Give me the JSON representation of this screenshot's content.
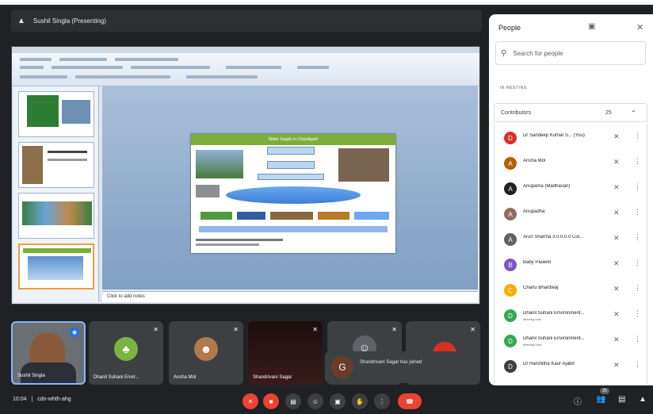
{
  "topbar": {
    "presenter_label": "Sushil Singla (Presenting)"
  },
  "presentation": {
    "notes_placeholder": "Click to add notes",
    "slide_title": "Water Supply in Chandigarh"
  },
  "tiles": [
    {
      "name": "Sushil Singla"
    },
    {
      "name": "Dhanil Suhani Envir..."
    },
    {
      "name": "Ansha Mol"
    },
    {
      "name": "Shandrivani Sagar"
    },
    {
      "name": ""
    },
    {
      "name": ""
    }
  ],
  "toast": {
    "avatar_letter": "G",
    "message": "Shandrivani Sagar has joined"
  },
  "bottom": {
    "time": "10:04",
    "separator": "|",
    "meeting_code": "cdn-whth-ahg"
  },
  "badge_count": "25",
  "people": {
    "title": "People",
    "search_placeholder": "Search for people",
    "section_label": "IN MEETING",
    "contributors_label": "Contributors",
    "contributors_count": "25",
    "items": [
      {
        "name": "Dr Sandeep Kumar S... (You)",
        "sub": "",
        "color": "#d93025",
        "letter": "D"
      },
      {
        "name": "Ansha Mol",
        "sub": "",
        "color": "#b06000",
        "letter": "A"
      },
      {
        "name": "Anupama (Madhavan)",
        "sub": "",
        "color": "#202124",
        "letter": "A"
      },
      {
        "name": "Anupadha",
        "sub": "",
        "color": "#8d6e63",
        "letter": "A"
      },
      {
        "name": "Arun Sharma 3.0.0.0.0 Col...",
        "sub": "",
        "color": "#5f6368",
        "letter": "A"
      },
      {
        "name": "Baby Pauwel",
        "sub": "",
        "color": "#7e57c2",
        "letter": "B"
      },
      {
        "name": "Charlu Bhardwaj",
        "sub": "",
        "color": "#f9ab00",
        "letter": "C"
      },
      {
        "name": "Dhanil Suhani Environment...",
        "sub": "Meeting host",
        "color": "#34a853",
        "letter": "D"
      },
      {
        "name": "Dhanil Suhani Environment...",
        "sub": "Meeting host",
        "color": "#34a853",
        "letter": "D"
      },
      {
        "name": "Dr Harshitha Kaur Ajabd",
        "sub": "",
        "color": "#3c4043",
        "letter": "D"
      }
    ]
  }
}
